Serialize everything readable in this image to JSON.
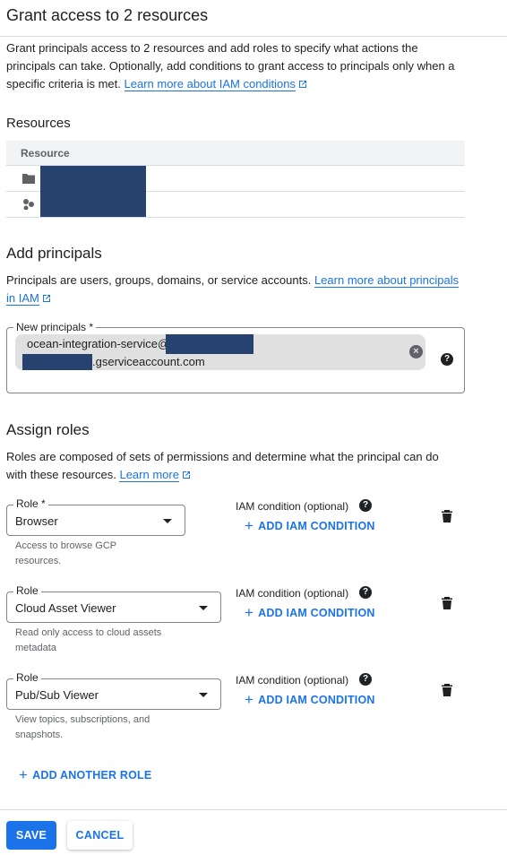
{
  "title": "Grant access to 2 resources",
  "intro": {
    "line1": "Grant principals access to 2 resources and add roles to specify what actions the",
    "line2": "principals can take. Optionally, add conditions to grant access to principals only when a",
    "line3_prefix": "specific criteria is met.",
    "link": "Learn more about IAM conditions"
  },
  "resources": {
    "heading": "Resources",
    "column_header": "Resource",
    "rows": [
      {
        "icon": "folder-icon"
      },
      {
        "icon": "project-hierarchy-icon"
      }
    ]
  },
  "principals": {
    "heading": "Add principals",
    "desc": "Principals are users, groups, domains, or service accounts.",
    "link_part1": "Learn more about principals",
    "link_part2": "in IAM",
    "field_label": "New principals *",
    "chip_line1": "ocean-integration-service@",
    "chip_line2": ".gserviceaccount.com"
  },
  "roles": {
    "heading": "Assign roles",
    "desc_line1": "Roles are composed of sets of permissions and determine what the principal can do",
    "desc_line2": "with these resources.",
    "link": "Learn more",
    "items": [
      {
        "label": "Role *",
        "value": "Browser",
        "hint1": "Access to browse GCP",
        "hint2": "resources.",
        "cond_label": "IAM condition (optional)",
        "add_cond": "ADD IAM CONDITION"
      },
      {
        "label": "Role",
        "value": "Cloud Asset Viewer",
        "hint1": "Read only access to cloud assets",
        "hint2": "metadata",
        "cond_label": "IAM condition (optional)",
        "add_cond": "ADD IAM CONDITION"
      },
      {
        "label": "Role",
        "value": "Pub/Sub Viewer",
        "hint1": "View topics, subscriptions, and",
        "hint2": "snapshots.",
        "cond_label": "IAM condition (optional)",
        "add_cond": "ADD IAM CONDITION"
      }
    ],
    "add_another": "ADD ANOTHER ROLE"
  },
  "footer": {
    "save": "SAVE",
    "cancel": "CANCEL"
  },
  "colors": {
    "accent": "#1a73e8",
    "redaction": "#26426e",
    "text": "#202124",
    "secondary_text": "#5f6368"
  }
}
